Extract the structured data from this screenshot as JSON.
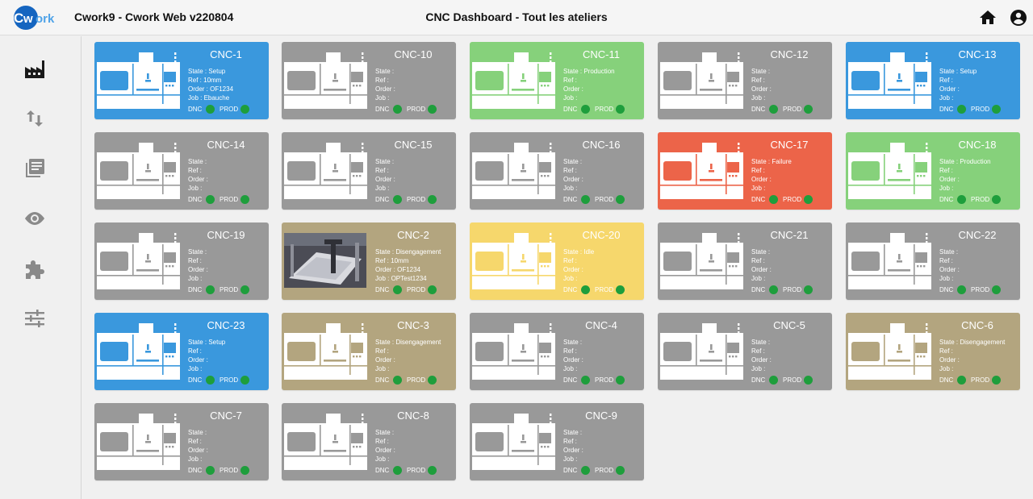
{
  "header": {
    "logo_text": "Cwork",
    "app_title": "Cwork9 - Cwork Web v220804",
    "page_title": "CNC Dashboard - Tout les ateliers",
    "icons": [
      "home-icon",
      "account-circle-icon"
    ]
  },
  "sidebar": {
    "items": [
      {
        "name": "factory",
        "icon": "factory-icon"
      },
      {
        "name": "transfer",
        "icon": "swap-vertical-icon"
      },
      {
        "name": "library",
        "icon": "library-books-icon"
      },
      {
        "name": "view",
        "icon": "eye-icon"
      },
      {
        "name": "extensions",
        "icon": "puzzle-icon"
      },
      {
        "name": "settings",
        "icon": "tune-icon"
      }
    ]
  },
  "colors": {
    "gray": "#999999",
    "blue": "#3a98dd",
    "green": "#86d17b",
    "red": "#ec6449",
    "khaki": "#b3a57f",
    "yellow": "#f6d76c",
    "status_dot": "#1e9e3c"
  },
  "labels": {
    "dnc": "DNC",
    "prod": "PROD"
  },
  "cards": [
    {
      "name": "CNC-1",
      "color": "blue",
      "state": "State : Setup",
      "ref": "Ref : 10mm",
      "order": "Order : OF1234",
      "job": "Job : Ebauche"
    },
    {
      "name": "CNC-10",
      "color": "gray",
      "state": "State :",
      "ref": "Ref :",
      "order": "Order :",
      "job": "Job :"
    },
    {
      "name": "CNC-11",
      "color": "green",
      "state": "State : Production",
      "ref": "Ref :",
      "order": "Order :",
      "job": "Job :"
    },
    {
      "name": "CNC-12",
      "color": "gray",
      "state": "State :",
      "ref": "Ref :",
      "order": "Order :",
      "job": "Job :"
    },
    {
      "name": "CNC-13",
      "color": "blue",
      "state": "State : Setup",
      "ref": "Ref :",
      "order": "Order :",
      "job": "Job :"
    },
    {
      "name": "CNC-14",
      "color": "gray",
      "state": "State :",
      "ref": "Ref :",
      "order": "Order :",
      "job": "Job :"
    },
    {
      "name": "CNC-15",
      "color": "gray",
      "state": "State :",
      "ref": "Ref :",
      "order": "Order :",
      "job": "Job :"
    },
    {
      "name": "CNC-16",
      "color": "gray",
      "state": "State :",
      "ref": "Ref :",
      "order": "Order :",
      "job": "Job :"
    },
    {
      "name": "CNC-17",
      "color": "red",
      "state": "State : Failure",
      "ref": "Ref :",
      "order": "Order :",
      "job": "Job :"
    },
    {
      "name": "CNC-18",
      "color": "green",
      "state": "State : Production",
      "ref": "Ref :",
      "order": "Order :",
      "job": "Job :"
    },
    {
      "name": "CNC-19",
      "color": "gray",
      "state": "State :",
      "ref": "Ref :",
      "order": "Order :",
      "job": "Job :"
    },
    {
      "name": "CNC-2",
      "color": "khaki",
      "photo": true,
      "state": "State : Disengagement",
      "ref": "Ref : 10mm",
      "order": "Order : OF1234",
      "job": "Job : OPTest1234"
    },
    {
      "name": "CNC-20",
      "color": "yellow",
      "state": "State : Idle",
      "ref": "Ref :",
      "order": "Order :",
      "job": "Job :"
    },
    {
      "name": "CNC-21",
      "color": "gray",
      "state": "State :",
      "ref": "Ref :",
      "order": "Order :",
      "job": "Job :"
    },
    {
      "name": "CNC-22",
      "color": "gray",
      "state": "State :",
      "ref": "Ref :",
      "order": "Order :",
      "job": "Job :"
    },
    {
      "name": "CNC-23",
      "color": "blue",
      "state": "State : Setup",
      "ref": "Ref :",
      "order": "Order :",
      "job": "Job :"
    },
    {
      "name": "CNC-3",
      "color": "khaki",
      "state": "State : Disengagement",
      "ref": "Ref :",
      "order": "Order :",
      "job": "Job :"
    },
    {
      "name": "CNC-4",
      "color": "gray",
      "state": "State :",
      "ref": "Ref :",
      "order": "Order :",
      "job": "Job :"
    },
    {
      "name": "CNC-5",
      "color": "gray",
      "state": "State :",
      "ref": "Ref :",
      "order": "Order :",
      "job": "Job :"
    },
    {
      "name": "CNC-6",
      "color": "khaki",
      "state": "State : Disengagement",
      "ref": "Ref :",
      "order": "Order :",
      "job": "Job :"
    },
    {
      "name": "CNC-7",
      "color": "gray",
      "state": "State :",
      "ref": "Ref :",
      "order": "Order :",
      "job": "Job :"
    },
    {
      "name": "CNC-8",
      "color": "gray",
      "state": "State :",
      "ref": "Ref :",
      "order": "Order :",
      "job": "Job :"
    },
    {
      "name": "CNC-9",
      "color": "gray",
      "state": "State :",
      "ref": "Ref :",
      "order": "Order :",
      "job": "Job :"
    }
  ]
}
